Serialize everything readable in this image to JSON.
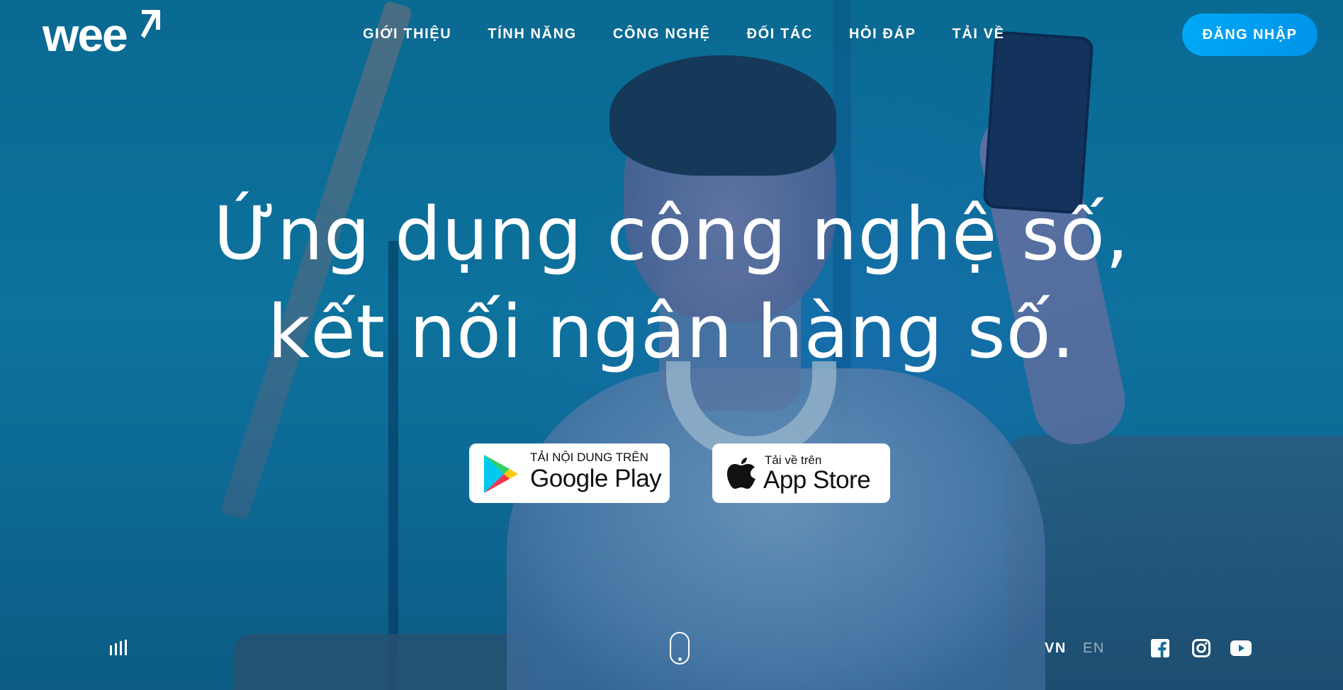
{
  "brand": {
    "logo_text": "wee"
  },
  "nav": {
    "items": [
      {
        "label": "GIỚI THIỆU"
      },
      {
        "label": "TÍNH NĂNG"
      },
      {
        "label": "CÔNG NGHỆ"
      },
      {
        "label": "ĐỐI TÁC"
      },
      {
        "label": "HỎI ĐÁP"
      },
      {
        "label": "TẢI VỀ"
      }
    ],
    "login_label": "ĐĂNG NHẬP"
  },
  "hero": {
    "line1": "Ứng dụng công nghệ số,",
    "line2": "kết nối ngân hàng số."
  },
  "badges": {
    "google": {
      "small": "TẢI NỘI DUNG TRÊN",
      "big": "Google Play",
      "icon": "google-play-icon"
    },
    "apple": {
      "small": "Tải về trên",
      "big": "App Store",
      "icon": "apple-icon"
    }
  },
  "footer": {
    "languages": {
      "vn": "VN",
      "en": "EN",
      "active": "VN"
    },
    "social_icons": [
      "facebook-icon",
      "instagram-icon",
      "youtube-icon"
    ],
    "left_icon": "equalizer-icon",
    "center_icon": "scroll-mouse-icon"
  },
  "colors": {
    "background": "#0e6f98",
    "login_button": "#00a0f0",
    "text": "#ffffff",
    "badge_bg": "#ffffff"
  }
}
